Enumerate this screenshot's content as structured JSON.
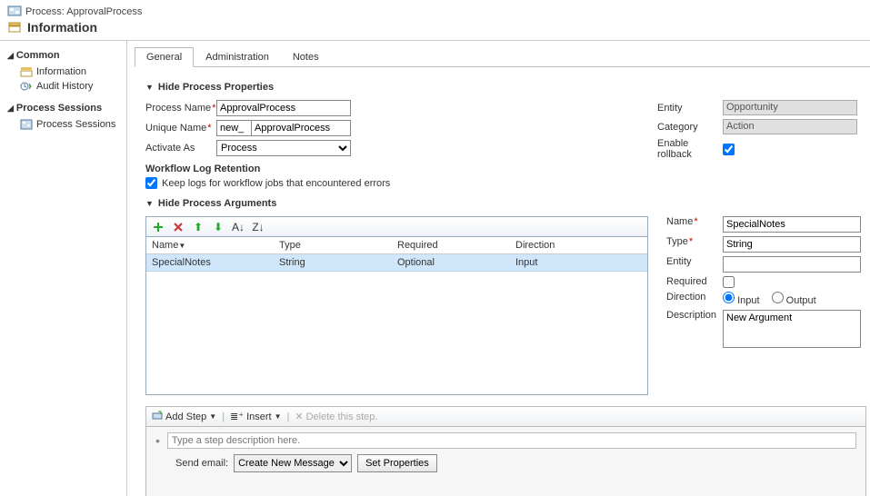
{
  "header": {
    "process_line": "Process: ApprovalProcess",
    "title": "Information"
  },
  "sidebar": {
    "common_heading": "Common",
    "information": "Information",
    "audit_history": "Audit History",
    "sessions_heading": "Process Sessions",
    "process_sessions": "Process Sessions"
  },
  "tabs": {
    "general": "General",
    "administration": "Administration",
    "notes": "Notes"
  },
  "sections": {
    "hide_properties": "Hide Process Properties",
    "hide_arguments": "Hide Process Arguments"
  },
  "props": {
    "process_name_label": "Process Name",
    "process_name_value": "ApprovalProcess",
    "unique_name_label": "Unique Name",
    "unique_prefix": "new_",
    "unique_value": "ApprovalProcess",
    "activate_as_label": "Activate As",
    "activate_as_value": "Process",
    "workflow_log_heading": "Workflow Log Retention",
    "keep_logs_label": "Keep logs for workflow jobs that encountered errors",
    "entity_label": "Entity",
    "entity_value": "Opportunity",
    "category_label": "Category",
    "category_value": "Action",
    "enable_rollback_label": "Enable rollback"
  },
  "args_grid": {
    "col_name": "Name",
    "col_type": "Type",
    "col_required": "Required",
    "col_direction": "Direction",
    "row": {
      "name": "SpecialNotes",
      "type": "String",
      "required": "Optional",
      "direction": "Input"
    }
  },
  "arg_detail": {
    "name_label": "Name",
    "name_value": "SpecialNotes",
    "type_label": "Type",
    "type_value": "String",
    "entity_label": "Entity",
    "entity_value": "",
    "required_label": "Required",
    "direction_label": "Direction",
    "direction_input": "Input",
    "direction_output": "Output",
    "description_label": "Description",
    "description_value": "New Argument"
  },
  "steps": {
    "add_step": "Add Step",
    "insert": "Insert",
    "delete": "Delete this step.",
    "placeholder": "Type a step description here.",
    "send_email_label": "Send email:",
    "send_email_value": "Create New Message",
    "set_properties": "Set Properties"
  }
}
